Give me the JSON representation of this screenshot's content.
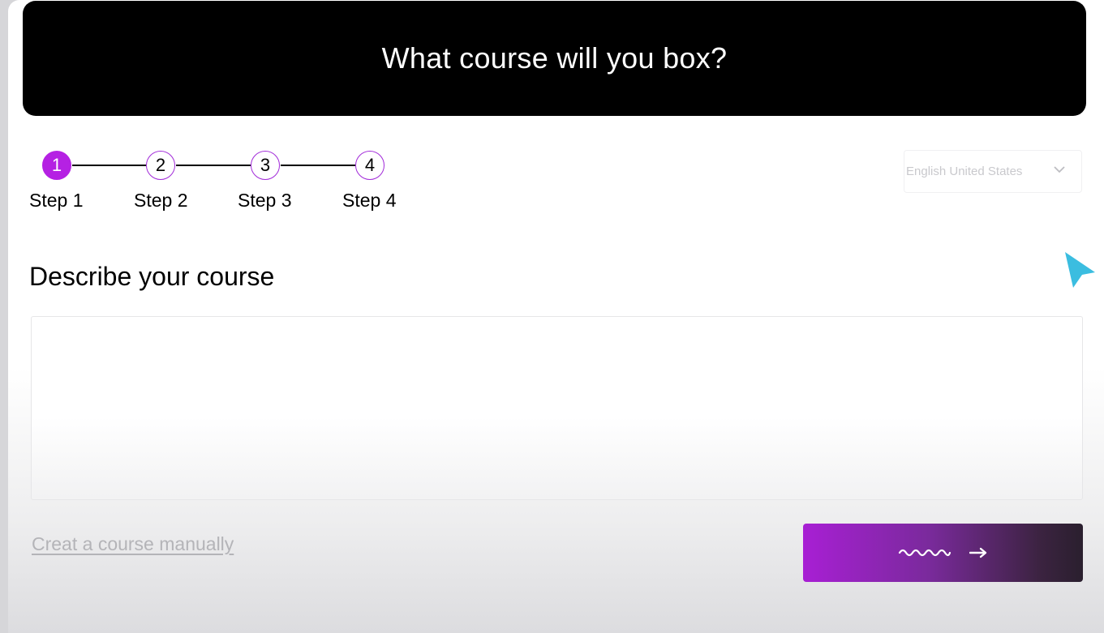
{
  "header": {
    "title": "What course will you box?"
  },
  "stepper": {
    "steps": [
      {
        "number": "1",
        "label": "Step 1",
        "active": true
      },
      {
        "number": "2",
        "label": "Step 2",
        "active": false
      },
      {
        "number": "3",
        "label": "Step 3",
        "active": false
      },
      {
        "number": "4",
        "label": "Step 4",
        "active": false
      }
    ]
  },
  "language_select": {
    "value": "English United States",
    "icon": "chevron-down-icon"
  },
  "main": {
    "section_title": "Describe your course",
    "description_value": "",
    "manual_link": "Creat a course manually"
  },
  "submit_button": {
    "icons": [
      "wave-loading-icon",
      "arrow-right-icon"
    ]
  },
  "colors": {
    "accent": "#b521e3",
    "header_bg": "#000000",
    "button_gradient_start": "#a81fd4",
    "button_gradient_end": "#2a1f2e",
    "cursor": "#3bbde0"
  }
}
